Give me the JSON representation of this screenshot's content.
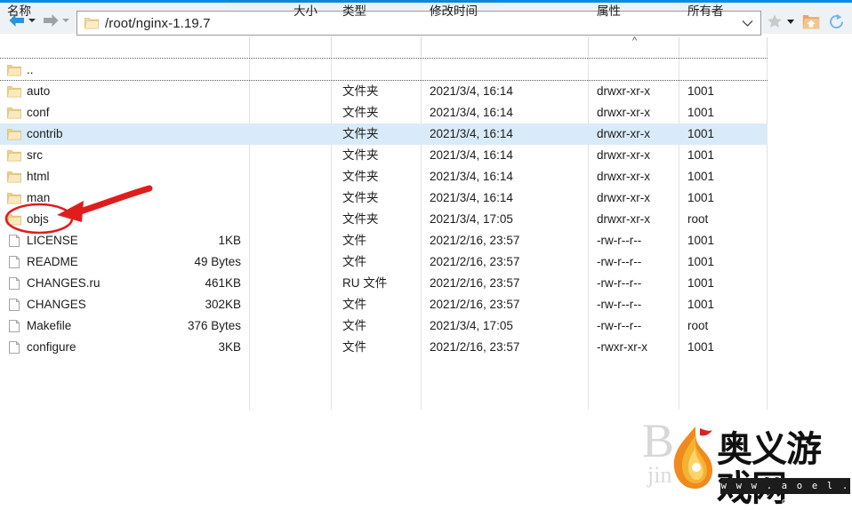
{
  "window": {
    "accent_color": "#0c8ce0"
  },
  "toolbar": {
    "back_label": "back-arrow",
    "forward_label": "forward-arrow",
    "address_value": "/root/nginx-1.19.7",
    "address_placeholder": "",
    "star_label": "bookmark",
    "home_label": "home",
    "reload_label": "refresh"
  },
  "columns": [
    {
      "key": "name",
      "label": "名称",
      "sorted": false
    },
    {
      "key": "size",
      "label": "大小",
      "sorted": false
    },
    {
      "key": "type",
      "label": "类型",
      "sorted": false
    },
    {
      "key": "time",
      "label": "修改时间",
      "sorted": false
    },
    {
      "key": "attr",
      "label": "属性",
      "sorted": true,
      "sort_glyph": "^"
    },
    {
      "key": "owner",
      "label": "所有者",
      "sorted": false
    }
  ],
  "rows": [
    {
      "icon": "folder",
      "name": "..",
      "size": "",
      "type": "",
      "time": "",
      "attr": "",
      "owner": "",
      "selected": false
    },
    {
      "icon": "folder",
      "name": "auto",
      "size": "",
      "type": "文件夹",
      "time": "2021/3/4, 16:14",
      "attr": "drwxr-xr-x",
      "owner": "1001",
      "selected": false
    },
    {
      "icon": "folder",
      "name": "conf",
      "size": "",
      "type": "文件夹",
      "time": "2021/3/4, 16:14",
      "attr": "drwxr-xr-x",
      "owner": "1001",
      "selected": false
    },
    {
      "icon": "folder",
      "name": "contrib",
      "size": "",
      "type": "文件夹",
      "time": "2021/3/4, 16:14",
      "attr": "drwxr-xr-x",
      "owner": "1001",
      "selected": true
    },
    {
      "icon": "folder",
      "name": "src",
      "size": "",
      "type": "文件夹",
      "time": "2021/3/4, 16:14",
      "attr": "drwxr-xr-x",
      "owner": "1001",
      "selected": false
    },
    {
      "icon": "folder",
      "name": "html",
      "size": "",
      "type": "文件夹",
      "time": "2021/3/4, 16:14",
      "attr": "drwxr-xr-x",
      "owner": "1001",
      "selected": false
    },
    {
      "icon": "folder",
      "name": "man",
      "size": "",
      "type": "文件夹",
      "time": "2021/3/4, 16:14",
      "attr": "drwxr-xr-x",
      "owner": "1001",
      "selected": false
    },
    {
      "icon": "folder",
      "name": "objs",
      "size": "",
      "type": "文件夹",
      "time": "2021/3/4, 17:05",
      "attr": "drwxr-xr-x",
      "owner": "root",
      "selected": false
    },
    {
      "icon": "file",
      "name": "LICENSE",
      "size": "1KB",
      "type": "文件",
      "time": "2021/2/16, 23:57",
      "attr": "-rw-r--r--",
      "owner": "1001",
      "selected": false
    },
    {
      "icon": "file",
      "name": "README",
      "size": "49 Bytes",
      "type": "文件",
      "time": "2021/2/16, 23:57",
      "attr": "-rw-r--r--",
      "owner": "1001",
      "selected": false
    },
    {
      "icon": "file",
      "name": "CHANGES.ru",
      "size": "461KB",
      "type": "RU 文件",
      "time": "2021/2/16, 23:57",
      "attr": "-rw-r--r--",
      "owner": "1001",
      "selected": false
    },
    {
      "icon": "file",
      "name": "CHANGES",
      "size": "302KB",
      "type": "文件",
      "time": "2021/2/16, 23:57",
      "attr": "-rw-r--r--",
      "owner": "1001",
      "selected": false
    },
    {
      "icon": "file",
      "name": "Makefile",
      "size": "376 Bytes",
      "type": "文件",
      "time": "2021/3/4, 17:05",
      "attr": "-rw-r--r--",
      "owner": "root",
      "selected": false
    },
    {
      "icon": "file",
      "name": "configure",
      "size": "3KB",
      "type": "文件",
      "time": "2021/2/16, 23:57",
      "attr": "-rwxr-xr-x",
      "owner": "1001",
      "selected": false
    }
  ],
  "annotation": {
    "color": "#e01d1d",
    "circled_item": "objs",
    "shape": "ellipse-with-arrow"
  },
  "watermark": {
    "brand": "奥义游戏网",
    "url": "w w w . a o e l . c o m",
    "bg_text": "B",
    "bg_text2": "jin"
  }
}
